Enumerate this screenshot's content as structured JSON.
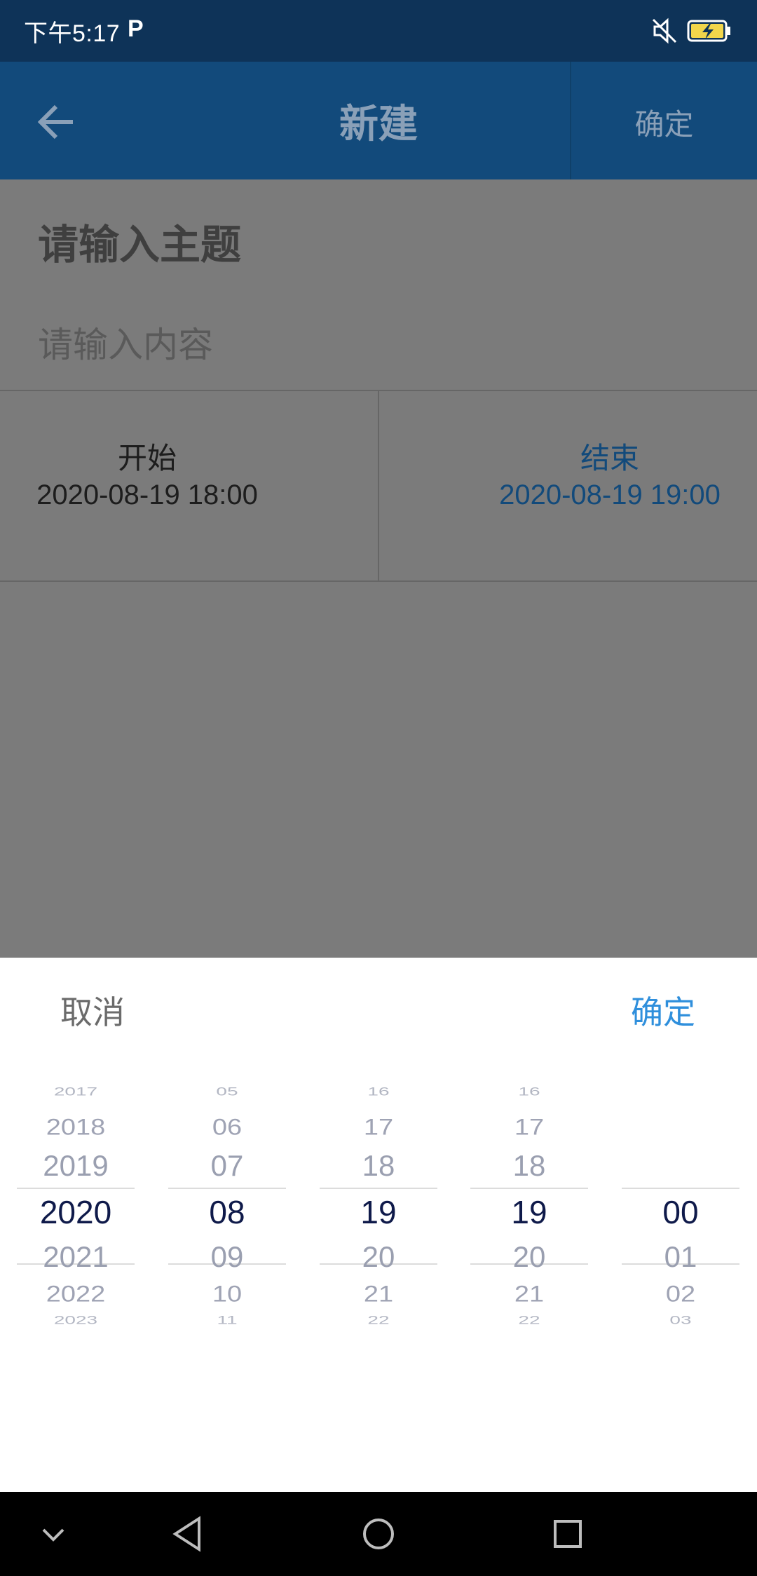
{
  "status_bar": {
    "time": "下午5:17",
    "p_label": "P"
  },
  "app_bar": {
    "title": "新建",
    "confirm_label": "确定"
  },
  "form": {
    "subject_placeholder": "请输入主题",
    "content_placeholder": "请输入内容",
    "start_label": "开始",
    "start_value": "2020-08-19 18:00",
    "end_label": "结束",
    "end_value": "2020-08-19 19:00"
  },
  "picker": {
    "cancel_label": "取消",
    "ok_label": "确定",
    "columns": [
      {
        "name": "year",
        "items": [
          "2017",
          "2018",
          "2019",
          "2020",
          "2021",
          "2022",
          "2023"
        ],
        "selected": "2020"
      },
      {
        "name": "month",
        "items": [
          "05",
          "06",
          "07",
          "08",
          "09",
          "10",
          "11"
        ],
        "selected": "08"
      },
      {
        "name": "day",
        "items": [
          "16",
          "17",
          "18",
          "19",
          "20",
          "21",
          "22"
        ],
        "selected": "19"
      },
      {
        "name": "hour",
        "items": [
          "16",
          "17",
          "18",
          "19",
          "20",
          "21",
          "22"
        ],
        "selected": "19"
      },
      {
        "name": "minute",
        "items": [
          "",
          "",
          "",
          "00",
          "01",
          "02",
          "03"
        ],
        "selected": "00"
      }
    ]
  },
  "colors": {
    "accent": "#2f8fdc",
    "appbar": "#124a7b",
    "statusbar": "#0e3358"
  }
}
